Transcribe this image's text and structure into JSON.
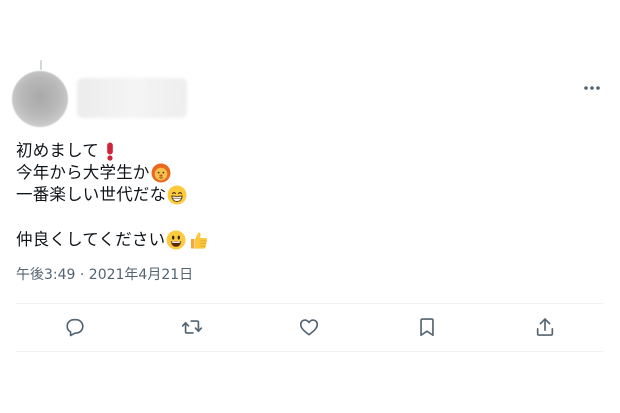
{
  "tweet": {
    "lines": [
      "初めまして",
      "今年から大学生か",
      "一番楽しい世代だな",
      "仲良くしてください"
    ],
    "timestamp": "午後3:49 · 2021年4月21日"
  },
  "icons": {
    "more": "more-horizontal-icon",
    "reply": "reply-icon",
    "retweet": "retweet-icon",
    "like": "heart-icon",
    "bookmark": "bookmark-icon",
    "share": "share-icon",
    "emojis": [
      "exclamation-icon",
      "lion-face-icon",
      "grinning-face-icon",
      "smiley-face-icon",
      "thumbs-up-icon"
    ]
  },
  "colors": {
    "text": "#0f1419",
    "secondary": "#536471",
    "divider": "#eff3f4"
  }
}
